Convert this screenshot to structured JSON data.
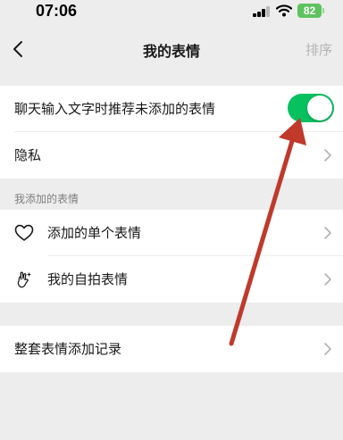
{
  "status_bar": {
    "time": "07:06",
    "battery": "82"
  },
  "nav": {
    "title": "我的表情",
    "right_action": "排序"
  },
  "settings": [
    {
      "label": "聊天输入文字时推荐未添加的表情",
      "toggle_on": true
    },
    {
      "label": "隐私"
    }
  ],
  "section_header": "我添加的表情",
  "added_items": [
    {
      "label": "添加的单个表情",
      "icon": "heart-icon"
    },
    {
      "label": "我的自拍表情",
      "icon": "selfie-hand-icon"
    }
  ],
  "history": {
    "label": "整套表情添加记录"
  },
  "colors": {
    "accent": "#07c160",
    "annotation_arrow": "#c0392b",
    "background": "#ededed"
  }
}
